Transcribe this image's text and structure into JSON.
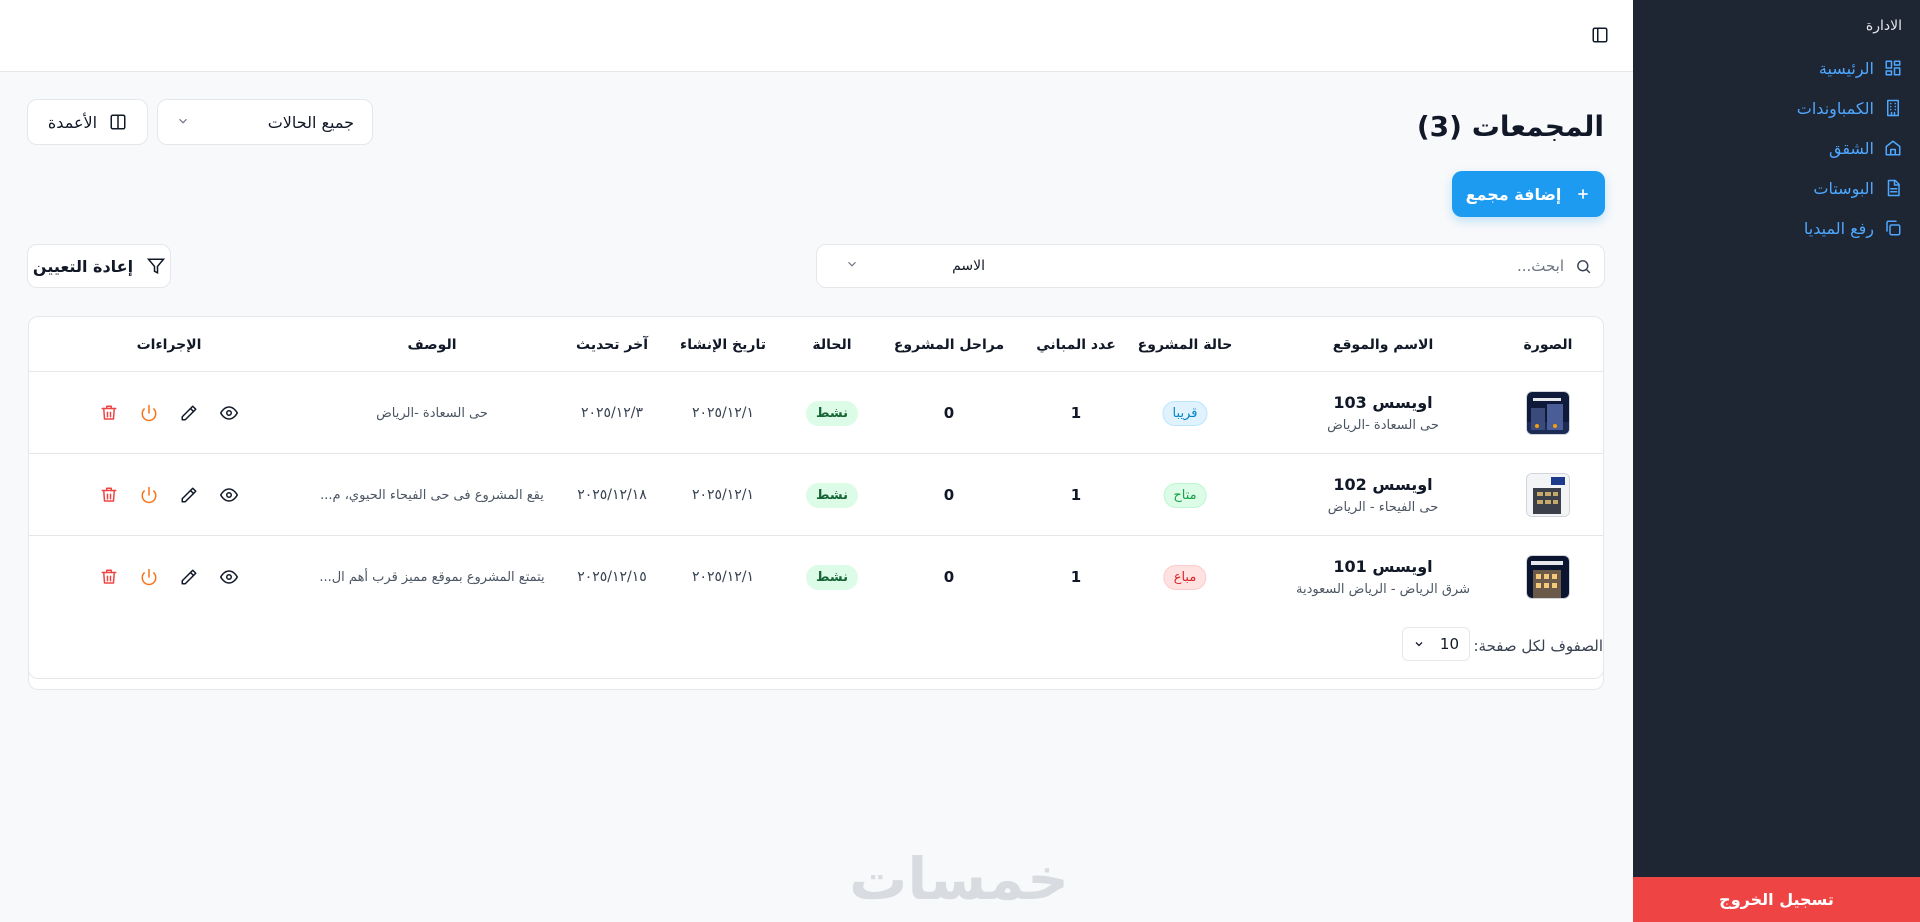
{
  "sidebar": {
    "group_label": "الادارة",
    "items": [
      {
        "label": "الرئيسية",
        "icon": "dashboard-icon"
      },
      {
        "label": "الكمباوندات",
        "icon": "building-icon"
      },
      {
        "label": "الشقق",
        "icon": "home-icon"
      },
      {
        "label": "البوستات",
        "icon": "document-icon"
      },
      {
        "label": "رفع الميديا",
        "icon": "copy-icon"
      }
    ],
    "logout_label": "تسجيل الخروج"
  },
  "header": {
    "toggle_icon": "sidebar-toggle-icon"
  },
  "page": {
    "title": "المجمعات (3)",
    "status_filter": "جميع الحالات",
    "columns_label": "الأعمدة",
    "add_label": "إضافة مجمع",
    "search_placeholder": "ابحث...",
    "search_field": "الاسم",
    "reset_label": "إعادة التعيين"
  },
  "table": {
    "headers": {
      "image": "الصورة",
      "name": "الاسم والموقع",
      "project_status": "حالة المشروع",
      "buildings": "عدد المباني",
      "phases": "مراحل المشروع",
      "status": "الحالة",
      "created": "تاريخ الإنشاء",
      "updated": "آخر تحديث",
      "description": "الوصف",
      "actions": "الإجراءات"
    },
    "rows": [
      {
        "name": "اويسس 103",
        "location": "حى السعادة -الرياض",
        "project_status": "قريبا",
        "project_status_kind": "soon",
        "buildings": "1",
        "phases": "0",
        "status": "نشط",
        "created": "٢٠٢٥/١٢/١",
        "updated": "٢٠٢٥/١٢/٣",
        "description": "حى السعادة -الرياض"
      },
      {
        "name": "اويسس 102",
        "location": "حى الفيحاء - الرياض",
        "project_status": "متاح",
        "project_status_kind": "avail",
        "buildings": "1",
        "phases": "0",
        "status": "نشط",
        "created": "٢٠٢٥/١٢/١",
        "updated": "٢٠٢٥/١٢/١٨",
        "description": "يقع المشروع فى حى الفيحاء الحيوي، م..."
      },
      {
        "name": "اويسس 101",
        "location": "شرق الرياض - الرياض السعودية",
        "project_status": "مباع",
        "project_status_kind": "sold",
        "buildings": "1",
        "phases": "0",
        "status": "نشط",
        "created": "٢٠٢٥/١٢/١",
        "updated": "٢٠٢٥/١٢/١٥",
        "description": "يتمتع المشروع بموقع مميز قرب أهم ال..."
      }
    ]
  },
  "pagination": {
    "rows_per_page_label": "الصفوف لكل صفحة:",
    "rows_per_page": "10"
  },
  "watermark": "خمسات",
  "colors": {
    "sidebar_bg": "#1e2533",
    "accent": "#1d9bf0",
    "logout": "#ef4444"
  }
}
